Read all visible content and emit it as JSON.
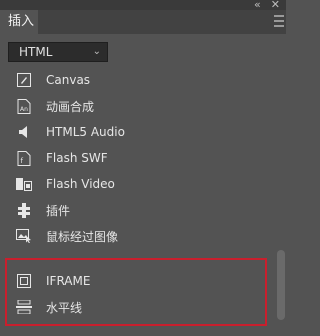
{
  "window": {
    "collapse_glyph": "«",
    "close_glyph": "✕"
  },
  "panel": {
    "tab_label": "插入"
  },
  "category_select": {
    "value": "HTML",
    "chevron": "⌄"
  },
  "items": [
    {
      "label": "Canvas",
      "icon": "canvas-icon"
    },
    {
      "label": "动画合成",
      "icon": "animation-composition-icon"
    },
    {
      "label": "HTML5 Audio",
      "icon": "speaker-icon"
    },
    {
      "label": "Flash SWF",
      "icon": "flash-swf-icon"
    },
    {
      "label": "Flash Video",
      "icon": "flash-video-icon"
    },
    {
      "label": "插件",
      "icon": "plugin-icon"
    },
    {
      "label": "鼠标经过图像",
      "icon": "rollover-image-icon"
    }
  ],
  "highlighted_items": [
    {
      "label": "IFRAME",
      "icon": "iframe-icon"
    },
    {
      "label": "水平线",
      "icon": "horizontal-rule-icon"
    }
  ],
  "colors": {
    "highlight_border": "#c91f2d",
    "panel_bg": "#535353"
  }
}
